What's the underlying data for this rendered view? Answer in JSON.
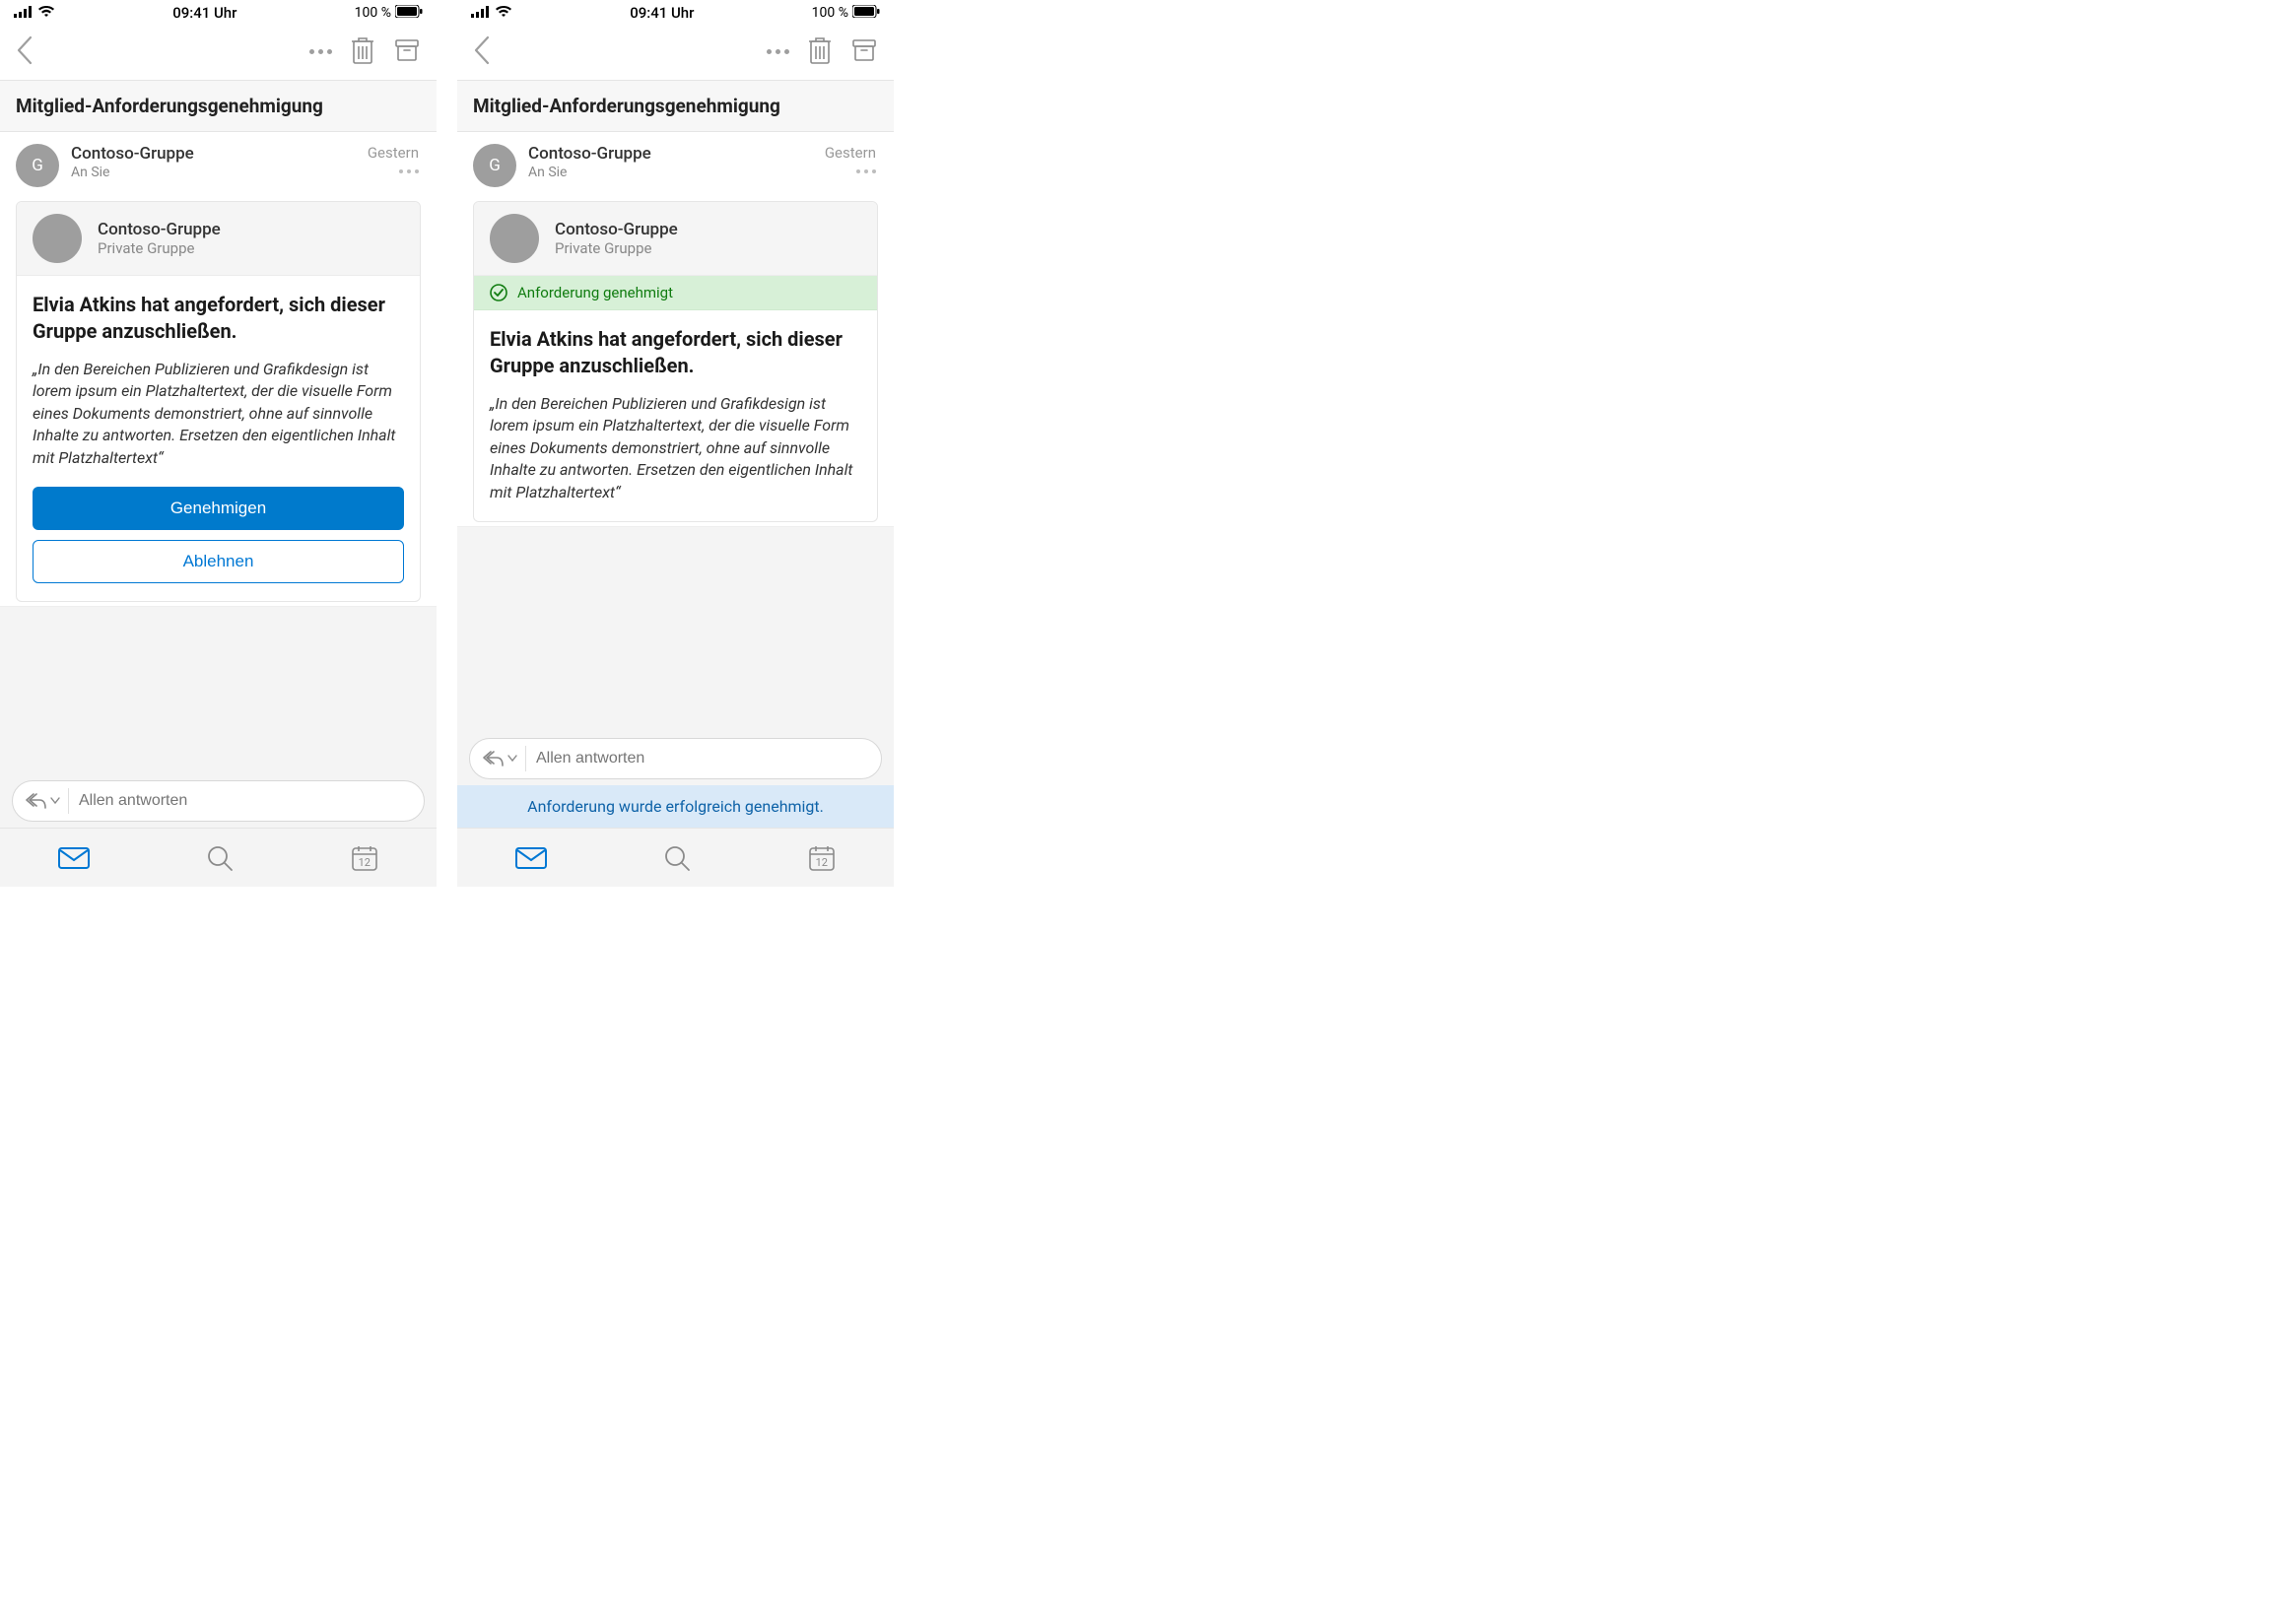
{
  "status": {
    "time": "09:41 Uhr",
    "battery": "100 %"
  },
  "nav": {
    "more_name": "more-icon",
    "trash_name": "trash-icon",
    "archive_name": "archive-icon"
  },
  "title": "Mitglied-Anforderungsgenehmigung",
  "sender": {
    "initial": "G",
    "name": "Contoso-Gruppe",
    "to": "An Sie",
    "when": "Gestern"
  },
  "card": {
    "group_name": "Contoso-Gruppe",
    "group_type": "Private Gruppe",
    "approved_label": "Anforderung genehmigt",
    "headline": "Elvia Atkins hat angefordert, sich dieser Gruppe anzuschließen.",
    "body": "„In den Bereichen Publizieren und Grafikdesign ist lorem ipsum ein Platzhaltertext, der die visuelle Form eines Dokuments demonstriert, ohne auf sinnvolle Inhalte zu antworten. Ersetzen den eigentlichen Inhalt mit Platzhaltertext“",
    "approve": "Genehmigen",
    "reject": "Ablehnen"
  },
  "reply": {
    "placeholder": "Allen antworten"
  },
  "toast": "Anforderung wurde erfolgreich genehmigt.",
  "tabs": {
    "mail": "mail-icon",
    "search": "search-icon",
    "cal": "calendar-icon",
    "cal_day": "12"
  }
}
